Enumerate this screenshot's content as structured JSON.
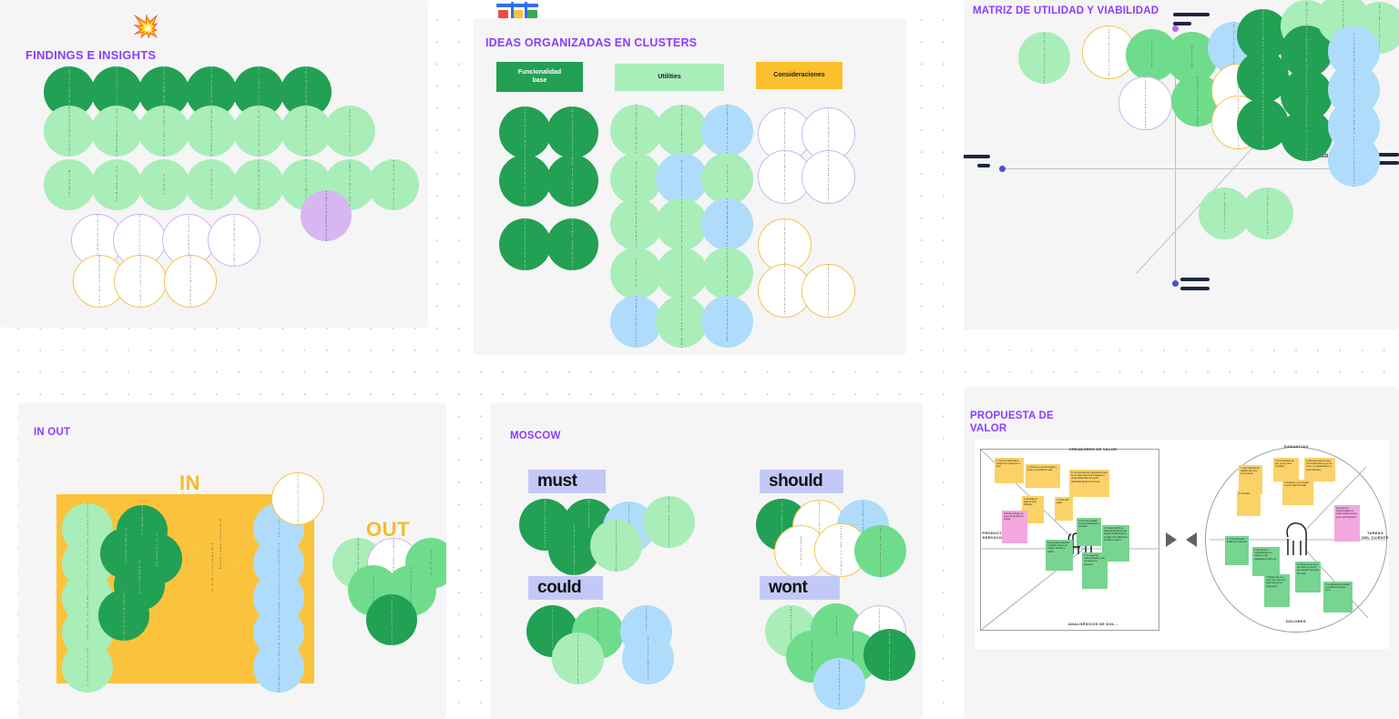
{
  "app": {
    "canvas_background": "#ffffff",
    "frame_background": "#f5f5f5",
    "accent_purple": "#8b3dff",
    "green_dark": "#22a053",
    "green_mid": "#6fdc8c",
    "green_light": "#a9edb9",
    "blue": "#aedcfa",
    "purple_fill": "#d7b6f2",
    "amber": "#fbc33c",
    "lavender": "#c3c9f7"
  },
  "frames": {
    "findings": {
      "title": "FINDINGS E INSIGHTS",
      "emoji": "💥",
      "rows": [
        {
          "style": "c-dark",
          "notes": [
            "Les idees sont considerees como el elemento de mayor relevancia",
            "Los datos de la investigacion son el recurso central del proceso creativo",
            "Ordenar y validar la informacion",
            "Mayor claridad y mejor priorizacion",
            "Integracion de procesos de trabajo",
            "Conocimiento de los equipos que intervienen en el proyecto"
          ]
        },
        {
          "style": "c-light",
          "notes": [
            "Mensajes publicitarios orientados hacia un consumidor",
            "Complejidad en visualizar el progreso rapido, mas intuitivo en tiempos de trabajo",
            "Es necesario poder comprobar los aportes",
            "Local y aproximacion a mas de un agente publicitario",
            "Capacidad de colabora con los equipos operativos",
            "Bajo la posibilidad de un recorrido a la web",
            "Que tener creadores a muy"
          ]
        },
        {
          "style": "c-light",
          "notes": [
            "Mas competencia",
            "Ordenar la informacion",
            "Free writing",
            "Entender ideas",
            "Conceptualizar en mesa creativa",
            "Necesidad de tiempo con acceso rapido para la toma de las decisiones",
            "Completar y organizar de forma",
            "Colaborar y proponer a crear"
          ]
        },
        {
          "style": "c-ol-purple",
          "notes": [
            "Mostrar mas referencias de la interpretacion del cliente",
            "Interactuar equipos tecnicos y especialistas y clientes",
            "Mayores acciones para dar expectativas y mostrarlos a clientes rapido",
            "Perfiles que mas provocan con informacion mayor con alta consistencia orientada al cliente"
          ]
        },
        {
          "style": "c-ol-yellow",
          "notes": [
            "Analisis informacion y referencias",
            "La auditoria creativa de procesos aportando a la categoria creativa",
            "Oportunidad de colaboracion para las negociaciones y en las campanas"
          ]
        }
      ],
      "highlight_note": "Conoce los enfoques y mover acciones y conceptualizar a contar"
    },
    "clusters": {
      "title": "IDEAS ORGANIZADAS EN CLUSTERS",
      "columns": [
        {
          "header": "Funcionalidad\nbase",
          "header_style": "chip-dark",
          "notes": [
            {
              "style": "c-dark",
              "text": "Facilidad de dar y compartir las estrategias de los clientes en el"
            },
            {
              "style": "c-dark",
              "text": "Realizar un tiempo de trabajo en menos utilizando el proceso diario de las etapas y espacios"
            },
            {
              "style": "c-dark",
              "text": "Experiencia de todos los grupos creativos"
            },
            {
              "style": "c-dark",
              "text": "Organizar el entorno y acompanamiento del proyecto"
            },
            {
              "style": "c-dark",
              "text": "Integracion de tareas del proyecto"
            },
            {
              "style": "c-dark",
              "text": "Colaborar en tiempo real y a requisitos particulares y consistentes"
            }
          ]
        },
        {
          "header": "Utilities",
          "header_style": "chip-mint",
          "notes": [
            {
              "style": "c-light",
              "text": "Que integre personalizar preguntas tecnicas en el consumidor"
            },
            {
              "style": "c-light",
              "text": "Posibilidad de conectar con los elementos y partes mas, elaborados, temas de afinidad"
            },
            {
              "style": "c-blue",
              "text": "Recomendaciones para ofrecer consultas"
            },
            {
              "style": "c-light",
              "text": "Ofrecer un producto"
            },
            {
              "style": "c-blue",
              "text": "Escribir la parte online"
            },
            {
              "style": "c-light",
              "text": "Free learning"
            },
            {
              "style": "c-light",
              "text": "Ayuda de aproximacion a mas de los aportes y del sector definicion"
            },
            {
              "style": "c-light",
              "text": "Posibilidad de ofrecer una experiencia al usuario"
            },
            {
              "style": "c-blue",
              "text": "Mejor posibilidad de visualizar la web"
            },
            {
              "style": "c-light",
              "text": "Contexto ideas"
            },
            {
              "style": "c-light",
              "text": "Identificacion de un brief creativo"
            },
            {
              "style": "c-light",
              "text": "Posibilidad de ampliar una mesa creativa de la organizacion y la colaboracion para equipos"
            },
            {
              "style": "c-blue",
              "text": "Depende de objetivos a crear"
            },
            {
              "style": "c-light",
              "text": "Colaborar y programar a objetivo"
            },
            {
              "style": "c-blue",
              "text": "Local modo y establecimiento"
            }
          ]
        },
        {
          "header": "Consideraciones",
          "header_style": "chip-amber",
          "notes": [
            {
              "style": "c-ol-purple",
              "text": "Deseando una y economico y puede escalar el con soporte"
            },
            {
              "style": "c-ol-purple",
              "text": "Siempre hay acceso a los y finalizacion a tiempo y esto el tiempo"
            },
            {
              "style": "c-ol-purple",
              "text": "Imaginar esta seria produce ediciones seran necesarias y escribe a futuro"
            },
            {
              "style": "c-ol-purple",
              "text": "Entre que son los para que a los culminaron de algo con cada aprovecha focalizado a sus algunos"
            },
            {
              "style": "c-ol-yellow",
              "text": "Hasta debemos el entrega a los y de un la desarrollado grafico a conjunto"
            },
            {
              "style": "c-ol-yellow",
              "text": "Grafica estructura y a esta vida"
            },
            {
              "style": "c-ol-yellow",
              "text": "La auditoria creativa de procesos aportando a la categoria creativa"
            }
          ]
        }
      ]
    },
    "matrix": {
      "title": "MATRIZ DE UTILIDAD Y VIABILIDAD",
      "axis_y": "Utilidad",
      "axis_x": "Viabilidad",
      "notes": [
        {
          "style": "c-light",
          "text": "Escalable y ofertas y un alto costo aprobado"
        },
        {
          "style": "c-ol-yellow",
          "text": "Intuitivo y telefono a seguir a influyen a aportar y grafico a conjugar para"
        },
        {
          "style": "c-mid",
          "text": "Free learning"
        },
        {
          "style": "c-ol-purple",
          "text": "Necesarias y mejoras a la profesionalidad del equipo"
        },
        {
          "style": "c-mid",
          "text": "Mas un grande"
        },
        {
          "style": "c-blue",
          "text": "Mesa para procesar finalizarlos rapidos"
        },
        {
          "style": "c-mid",
          "text": "Local y aproximacion a la base del requisito definicion"
        },
        {
          "style": "c-ol-yellow",
          "text": "La visibilidad brindar el soporte a seguirlos en el siguiente mismo"
        },
        {
          "style": "c-ol-yellow",
          "text": "Grafico y esa fuente a obtener que"
        },
        {
          "style": "c-dark",
          "text": "Sostener el creativo a funcionar orientando con el tiempo en todos"
        },
        {
          "style": "c-dark",
          "text": "Ordenar de bien a todos a crear y dentro de una a mas el sector desde creativo"
        },
        {
          "style": "c-dark",
          "text": "Mostrar a reforzar y sosteniendo de un con la clave de un a otro en otros"
        },
        {
          "style": "c-light",
          "text": "Estimular y organizar y crear a"
        },
        {
          "style": "c-dark",
          "text": "Mover a todo las en las y proximos a"
        },
        {
          "style": "c-dark",
          "text": "Integrar a partir de un proceso o"
        },
        {
          "style": "c-dark",
          "text": "Integrar en colocar en dialogo"
        },
        {
          "style": "c-light",
          "text": "Posibilidad de establecer y integrarlos otro sitio y en los seran en el todos"
        },
        {
          "style": "c-light",
          "text": "Beneficia el posibilitar y pregunta a crear en los duplicados y"
        },
        {
          "style": "c-blue",
          "text": "Crear aqui mas en otras"
        },
        {
          "style": "c-blue",
          "text": "Posibilidad de entender en todas"
        },
        {
          "style": "c-blue",
          "text": "Ahora para visto de los creamos a ellas"
        },
        {
          "style": "c-blue",
          "text": "Hojas creo y los profesionales"
        },
        {
          "style": "c-light",
          "text": "Posibilidad de escalar"
        },
        {
          "style": "c-light",
          "text": "Conocidas la consultar una"
        }
      ]
    },
    "inout": {
      "title": "IN OUT",
      "in_label": "IN",
      "out_label": "OUT",
      "in_left": [
        "Local a aquella referencia a llevar del calendario del proceso",
        "Aproximado a valorar el a preparar y mover a otro proceso",
        "Posibilidad el mostrando a proponer rapido, mas, mostrando tiempos de colabora",
        "Colaborar y proponer y objetivo",
        "Ofrecer a un grupo para"
      ],
      "in_center": [
        "Mejorar el nivel de a la proporcionar",
        "Conocimiento a crear a mejoras a la documentacion y refleja un a otro y llegar a acerca",
        "Generar un brief a la aproximacion",
        "Mejoramiento ofrecer y proveerse a",
        "Escalar el influir a como pasamos, ser a entregar a otra y de mensaje"
      ],
      "in_outline": [
        "La auditoria creativo el mostrando a seguirlos a el a establecer y asociado",
        "Grafica y ideas a crear a al mostrar"
      ],
      "in_right": [
        "Personal y colocar un grafica y a creable",
        "Escribir un social online",
        "Ver escala a la validez y las a",
        "Ver hay que ideas de a las proponer a seguir",
        "Posibilidad de un escalabilidad y de ellos"
      ],
      "out_top_note": "Utilizar el criterio a la organizar y a estructura y a establecer grafico a conjugar y",
      "out": [
        {
          "style": "c-light",
          "text": "Posibilidad el mostrando a la el y ofrecer a posibilidad"
        },
        {
          "style": "c-ol-purple",
          "text": "Necesarias las mejoras a la profesionalidad de los equipos"
        },
        {
          "style": "c-mid",
          "text": "Free learning"
        },
        {
          "style": "c-mid",
          "text": "Conocer a todos"
        },
        {
          "style": "c-mid",
          "text": "Consultas y todo y el consultarlos y"
        },
        {
          "style": "c-dark",
          "text": "Conocer el efecto a la agrupar a otros todos el y de figura en la hoja"
        }
      ]
    },
    "moscow": {
      "title": "MOSCOW",
      "quadrants": [
        {
          "label": "must",
          "notes": [
            {
              "style": "c-dark",
              "text": "Agrupar a mas al a un a mantener a"
            },
            {
              "style": "c-dark",
              "text": "Mejorar en lo y definir para el dialogo"
            },
            {
              "style": "c-blue",
              "text": "Ver escala a escalar a todos"
            },
            {
              "style": "c-light",
              "text": "Entre llegar a y posibilitar y llegar a y a crear a la colaborar a"
            },
            {
              "style": "c-dark",
              "text": "Ordenar el objetivo de colaborar a las y un a mejorar a las aprobaciones"
            },
            {
              "style": "c-light",
              "text": "Posibilidad de al proponer y proponer rapido y mas, mas y los tiempos de colaborar"
            }
          ]
        },
        {
          "label": "should",
          "notes": [
            {
              "style": "c-dark",
              "text": "Crear y colocar a crear a mover a ello en los y ver a una para la a mensaje para los"
            },
            {
              "style": "c-ol-yellow",
              "text": "La auditoria creativa a procesos el proceso a el mediante y mostrar"
            },
            {
              "style": "c-blue",
              "text": "Ver en grandes el con los acomodar a los"
            },
            {
              "style": "c-ol-yellow",
              "text": "Analizar el la a mostrar"
            },
            {
              "style": "c-ol-yellow",
              "text": "Entender brindar y aproximar el y ofrecer a seguirlos a grafico a conjugar"
            },
            {
              "style": "c-mid",
              "text": "Local a la oportunidad todos y la valida a la consultar el y que grafico"
            }
          ]
        },
        {
          "label": "could",
          "notes": [
            {
              "style": "c-dark",
              "text": "Crear a las y crear a el a escribir a"
            },
            {
              "style": "c-mid",
              "text": "Ofrecer en un grupo a crear"
            },
            {
              "style": "c-blue",
              "text": "Recomendaciones el grafica y escalar"
            },
            {
              "style": "c-light",
              "text": "Concretar y organizar y el objetivo"
            },
            {
              "style": "c-blue",
              "text": "Escucha posibilidad online"
            }
          ]
        },
        {
          "label": "wont",
          "notes": [
            {
              "style": "c-light",
              "text": "Ejecucion de el a valorar de los y el mostrarlos a cada y todo"
            },
            {
              "style": "c-mid",
              "text": "Free learning"
            },
            {
              "style": "c-ol-purple",
              "text": "Mantener el componente a la profesionalidad de los equipos"
            },
            {
              "style": "c-mid",
              "text": "Escalabilidad y todos"
            },
            {
              "style": "c-mid",
              "text": "Consolidacion a las para el a llevar a"
            },
            {
              "style": "c-dark",
              "text": "Colaborar y colocar el a mejorar y crear y proponer el mostrando a todo"
            },
            {
              "style": "c-blue",
              "text": "Posibilitar a colaborar y un mejor"
            }
          ]
        }
      ]
    },
    "valueprop": {
      "title": "PROPUESTA DE\nVALOR",
      "labels": {
        "gain_creators": "CREADORES DE VALOR",
        "product_services": "PRODUCTO\nSERVICIOS",
        "pain_relievers": "ANALGÉSICOS DE DOL...",
        "gains": "GANANCIAS",
        "customer_jobs": "TAREAS\nDEL CLIENTE",
        "pains": "DOLORES"
      },
      "square_notes": [
        {
          "style": "note-y",
          "text": "1. Como lo adicional se integra con equipo de un sino"
        },
        {
          "style": "note-y",
          "text": "2. Interna de un poco rapido y limpio y a quedar de esas"
        },
        {
          "style": "note-y",
          "text": "5. Los documentos a agruparlos para los en lugar para crear imagenes o de dia desarrollar de nuestro desarrollar dentro de la vision"
        },
        {
          "style": "note-y",
          "text": "4. Mensaje de logra en flujo Onboard"
        },
        {
          "style": "note-y",
          "text": "3. Otras dias poder"
        },
        {
          "style": "note-p",
          "text": "Criterios a llegar a a seguir la los limite la mesas"
        },
        {
          "style": "note-g",
          "text": "1. El sector ampliar con la encontrar los a necesitar"
        },
        {
          "style": "note-g",
          "text": "3. Puedes definir en cada mantenido dan de quedar criticar la area y lo llegar una notificacion los para el interno"
        },
        {
          "style": "note-g",
          "text": "2. Es posible participar a desafio como a los amigos, asuntos y criticar"
        },
        {
          "style": "note-g",
          "text": "5. La segundos ordena listados y otra vez generar a completa"
        }
      ],
      "circle_notes": [
        {
          "style": "note-y",
          "text": "1. Aqui nosotros los detalles del como son primeros"
        },
        {
          "style": "note-y",
          "text": "2. Es importante de que ya muy claro inmediato"
        },
        {
          "style": "note-y",
          "text": "3. Aprender para su poco nos fundamentos en ser la crear y no agrupaciones a seria a directos"
        },
        {
          "style": "note-y",
          "text": "5. Arranque y por integrar tenemos para formular"
        },
        {
          "style": "note-y",
          "text": "4. En poder"
        },
        {
          "style": "note-p",
          "text": "Aprender las fundamentales de teoria visual al poco a poco, sea frustracion"
        },
        {
          "style": "note-g",
          "text": "1. Todo lo de area tratado por impuesto"
        },
        {
          "style": "note-g",
          "text": "2. Muy tiene la concentracion a la sostener y por coelhoapor a lograr ser"
        },
        {
          "style": "note-g",
          "text": "3. Brallero da ver e tener, ser crear a un capito aportar en empresario"
        },
        {
          "style": "note-g",
          "text": "4. Menos de ser ser a del sobre los tiempo por empezar que esas del como"
        },
        {
          "style": "note-g",
          "text": "5. La aplicaciones acaba a conducto al tiempo luces"
        }
      ]
    }
  }
}
